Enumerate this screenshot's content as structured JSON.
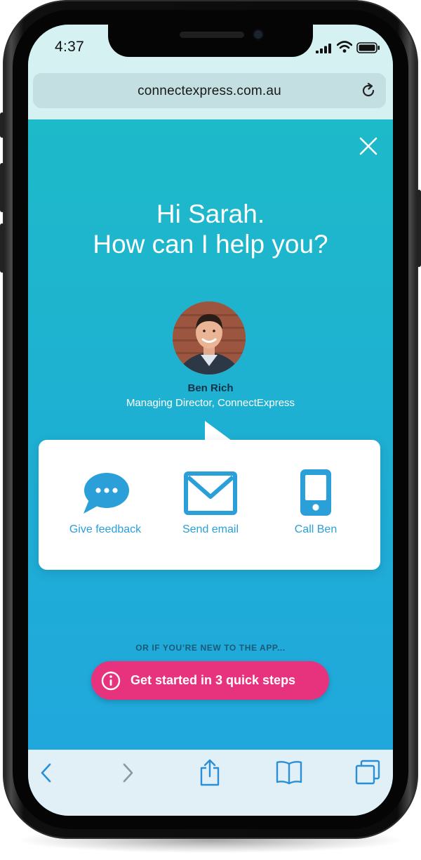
{
  "status_bar": {
    "time": "4:37"
  },
  "browser": {
    "url": "connectexpress.com.au"
  },
  "greeting": {
    "line1": "Hi Sarah.",
    "line2": "How can I help you?"
  },
  "contact": {
    "name": "Ben Rich",
    "role": "Managing Director, ConnectExpress"
  },
  "actions": [
    {
      "label": "Give feedback",
      "icon": "chat-bubble-icon"
    },
    {
      "label": "Send email",
      "icon": "envelope-icon"
    },
    {
      "label": "Call Ben",
      "icon": "mobile-phone-icon"
    }
  ],
  "onboarding": {
    "prompt": "OR IF YOU’RE NEW TO THE APP...",
    "button_label": "Get started in 3 quick steps"
  },
  "toolbar": {
    "icons": [
      "back-icon",
      "forward-icon",
      "share-icon",
      "bookmarks-icon",
      "tabs-icon"
    ]
  },
  "colors": {
    "accent_blue": "#2a9fd8",
    "cta_pink": "#e7337d",
    "gradient_top": "#1dbdc6",
    "gradient_bottom": "#21a6df"
  }
}
